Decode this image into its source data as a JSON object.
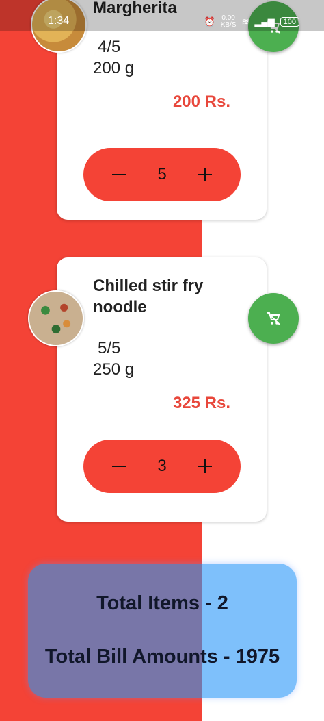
{
  "status_bar": {
    "time": "1:34",
    "net_speed_value": "0.00",
    "net_speed_unit": "KB/S",
    "battery": "100"
  },
  "cart_items": [
    {
      "name": "Margherita",
      "rating": "4/5",
      "weight": "200 g",
      "price": "200 Rs.",
      "quantity": "5",
      "image_icon": "pizza-image"
    },
    {
      "name": "Chilled stir fry noodle",
      "rating": "5/5",
      "weight": "250 g",
      "price": "325 Rs.",
      "quantity": "3",
      "image_icon": "noodle-image"
    }
  ],
  "summary": {
    "total_items": "Total Items - 2",
    "total_bill": "Total Bill Amounts - 1975"
  },
  "colors": {
    "primary_red": "#f44336",
    "price_red": "#e8473b",
    "fab_green": "#4caf50",
    "summary_purple": "#7876a8",
    "summary_blue": "#7ec0fb"
  },
  "icons": {
    "remove_from_cart": "remove-shopping-cart-icon",
    "minus": "minus-icon",
    "plus": "plus-icon"
  }
}
